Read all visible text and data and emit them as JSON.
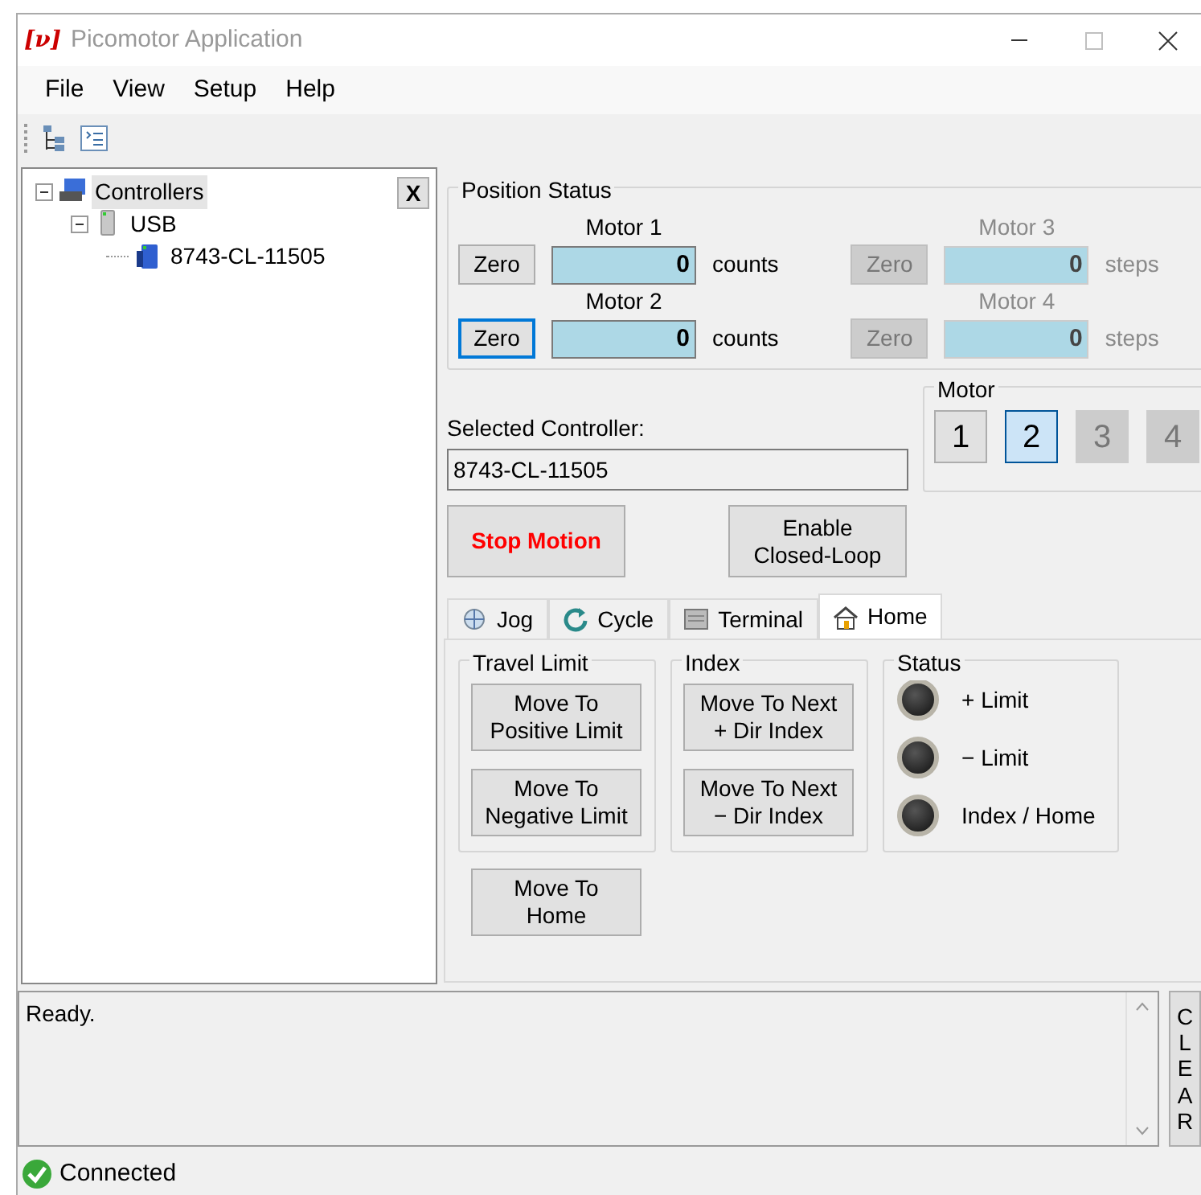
{
  "window": {
    "logo": "[ν]",
    "title": "Picomotor Application",
    "controls": [
      {
        "kind": "minimize",
        "disabled": false
      },
      {
        "kind": "maximize",
        "disabled": true
      },
      {
        "kind": "close",
        "disabled": false
      }
    ]
  },
  "menu": [
    "File",
    "View",
    "Setup",
    "Help"
  ],
  "toolbar": [
    {
      "kind": "tree"
    },
    {
      "kind": "list"
    }
  ],
  "tree": {
    "close_button": "X",
    "items": [
      {
        "label": "Controllers",
        "kind": "root",
        "selected": true,
        "expanded": true,
        "children": [
          {
            "label": "USB",
            "kind": "usb",
            "selected": false,
            "expanded": true,
            "children": [
              {
                "label": "8743-CL-11505",
                "kind": "device",
                "selected": false
              }
            ]
          }
        ]
      }
    ]
  },
  "position_status": {
    "title": "Position Status",
    "motors": [
      {
        "label": "Motor 1",
        "button": "Zero",
        "value": "0",
        "unit": "counts",
        "disabled": false,
        "focused": false
      },
      {
        "label": "Motor 2",
        "button": "Zero",
        "value": "0",
        "unit": "counts",
        "disabled": false,
        "focused": true
      },
      {
        "label": "Motor 3",
        "button": "Zero",
        "value": "0",
        "unit": "steps",
        "disabled": true,
        "focused": false
      },
      {
        "label": "Motor 4",
        "button": "Zero",
        "value": "0",
        "unit": "steps",
        "disabled": true,
        "focused": false
      }
    ]
  },
  "selected_controller": {
    "label": "Selected Controller:",
    "value": "8743-CL-11505"
  },
  "motor_select": {
    "title": "Motor",
    "buttons": [
      {
        "label": "1",
        "selected": false,
        "disabled": false
      },
      {
        "label": "2",
        "selected": true,
        "disabled": false
      },
      {
        "label": "3",
        "selected": false,
        "disabled": true
      },
      {
        "label": "4",
        "selected": false,
        "disabled": true
      }
    ]
  },
  "actions": [
    {
      "label": "Stop Motion",
      "kind": "stop"
    },
    {
      "label": "Enable\nClosed-Loop",
      "kind": "normal"
    }
  ],
  "tabs": [
    {
      "label": "Jog",
      "kind": "jog",
      "selected": false
    },
    {
      "label": "Cycle",
      "kind": "cycle",
      "selected": false
    },
    {
      "label": "Terminal",
      "kind": "terminal",
      "selected": false
    },
    {
      "label": "Home",
      "kind": "home",
      "selected": true
    }
  ],
  "home_panel": {
    "travel_limit": {
      "title": "Travel Limit",
      "buttons": [
        "Move To Positive Limit",
        "Move To Negative Limit"
      ]
    },
    "index": {
      "title": "Index",
      "buttons": [
        "Move To Next\n+ Dir Index",
        "Move To Next\n− Dir Index"
      ]
    },
    "status": {
      "title": "Status",
      "indicators": [
        {
          "label": "+ Limit",
          "on": false
        },
        {
          "label": "− Limit",
          "on": false
        },
        {
          "label": "Index / Home",
          "on": false
        }
      ]
    },
    "home_button": "Move To\nHome"
  },
  "log": {
    "text": "Ready.",
    "clear_button": "CLEAR"
  },
  "status_bar": {
    "text": "Connected",
    "connected": true
  }
}
